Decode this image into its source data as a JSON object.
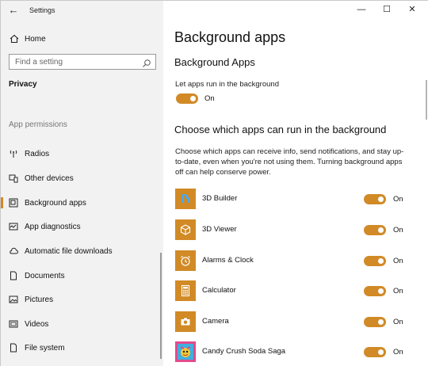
{
  "window": {
    "title": "Settings",
    "back": "←",
    "minimize": "—",
    "maximize": "☐",
    "close": "✕"
  },
  "sidebar": {
    "home": "Home",
    "search_placeholder": "Find a setting",
    "section": "Privacy",
    "group": "App permissions",
    "items": [
      {
        "label": "Radios",
        "icon": "radio-icon"
      },
      {
        "label": "Other devices",
        "icon": "devices-icon"
      },
      {
        "label": "Background apps",
        "icon": "background-apps-icon",
        "active": true
      },
      {
        "label": "App diagnostics",
        "icon": "diagnostics-icon"
      },
      {
        "label": "Automatic file downloads",
        "icon": "cloud-icon"
      },
      {
        "label": "Documents",
        "icon": "document-icon"
      },
      {
        "label": "Pictures",
        "icon": "picture-icon"
      },
      {
        "label": "Videos",
        "icon": "video-icon"
      },
      {
        "label": "File system",
        "icon": "file-icon"
      }
    ]
  },
  "main": {
    "title": "Background apps",
    "subtitle": "Background Apps",
    "let_apps_label": "Let apps run in the background",
    "let_apps_state": "On",
    "choose_heading": "Choose which apps can run in the background",
    "description": "Choose which apps can receive info, send notifications, and stay up-to-date, even when you're not using them. Turning background apps off can help conserve power.",
    "apps": [
      {
        "name": "3D Builder",
        "state": "On",
        "icon": "3d-builder-icon"
      },
      {
        "name": "3D Viewer",
        "state": "On",
        "icon": "3d-viewer-icon"
      },
      {
        "name": "Alarms & Clock",
        "state": "On",
        "icon": "alarm-clock-icon"
      },
      {
        "name": "Calculator",
        "state": "On",
        "icon": "calculator-icon"
      },
      {
        "name": "Camera",
        "state": "On",
        "icon": "camera-icon"
      },
      {
        "name": "Candy Crush Soda Saga",
        "state": "On",
        "icon": "candy-crush-icon"
      }
    ]
  },
  "colors": {
    "accent": "#d18a26",
    "sidebar_bg": "#f2f2f2"
  }
}
